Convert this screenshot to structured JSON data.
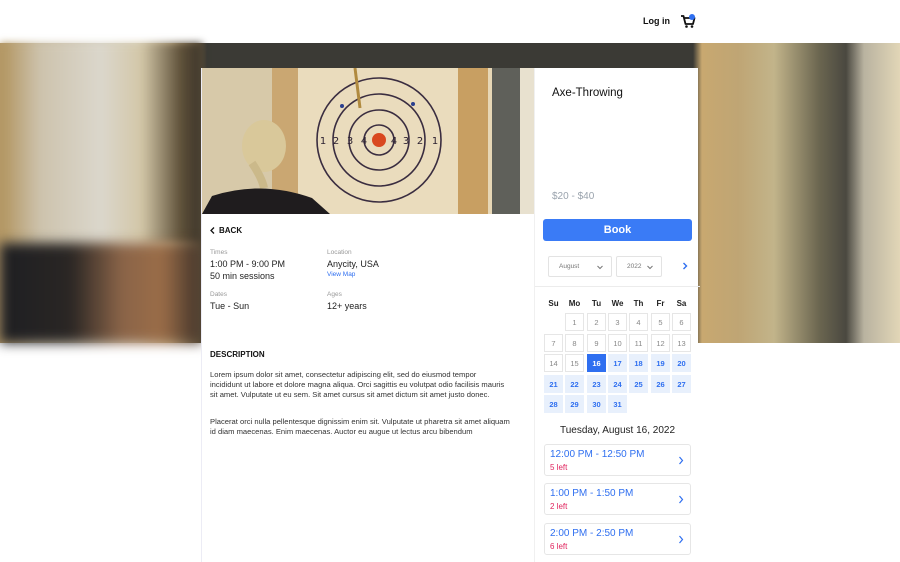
{
  "header": {
    "login_label": "Log in",
    "cart_icon": "shopping-cart-icon",
    "cart_badge_color": "#2f6ff0"
  },
  "activity": {
    "photo_alt": "Person facing an axe-throwing target",
    "back_label": "BACK",
    "times_label": "Times",
    "times_value": "1:00 PM - 9:00 PM",
    "session_length": "50 min sessions",
    "location_label": "Location",
    "location_value": "Anycity, USA",
    "view_map_label": "View Map",
    "dates_label": "Dates",
    "dates_value": "Tue - Sun",
    "ages_label": "Ages",
    "ages_value": "12+ years",
    "description_title": "DESCRIPTION",
    "description_paragraphs": [
      "Lorem ipsum dolor sit amet, consectetur adipiscing elit, sed do eiusmod tempor incididunt ut labore et dolore magna aliqua. Orci sagittis eu volutpat odio facilisis mauris sit amet. Vulputate ut eu sem. Sit amet cursus sit amet dictum sit amet justo donec.",
      "Placerat orci nulla pellentesque dignissim enim sit. Vulputate ut pharetra sit amet aliquam id diam maecenas. Enim maecenas. Auctor eu augue ut lectus arcu bibendum"
    ]
  },
  "booking": {
    "title": "Axe-Throwing",
    "price_range": "$20 - $40",
    "book_label": "Book",
    "accent_color": "#3a7bf6",
    "month_select": "August",
    "year_select": "2022",
    "weekdays": [
      "Su",
      "Mo",
      "Tu",
      "We",
      "Th",
      "Fr",
      "Sa"
    ],
    "calendar": {
      "first_weekday_index": 1,
      "days_in_month": 31,
      "past_days": [
        1,
        2,
        3,
        4,
        5,
        6,
        7,
        8,
        9,
        10,
        11,
        12,
        13,
        14,
        15
      ],
      "selected_day": 16,
      "available_days": [
        17,
        18,
        19,
        20,
        21,
        22,
        23,
        24,
        25,
        26,
        27,
        28,
        29,
        30,
        31
      ]
    },
    "selected_date_label": "Tuesday, August 16, 2022",
    "slots": [
      {
        "time": "12:00 PM - 12:50 PM",
        "remaining": "5 left"
      },
      {
        "time": "1:00 PM - 1:50 PM",
        "remaining": "2 left"
      },
      {
        "time": "2:00 PM - 2:50 PM",
        "remaining": "6 left"
      }
    ],
    "remaining_color": "#e0245e"
  }
}
